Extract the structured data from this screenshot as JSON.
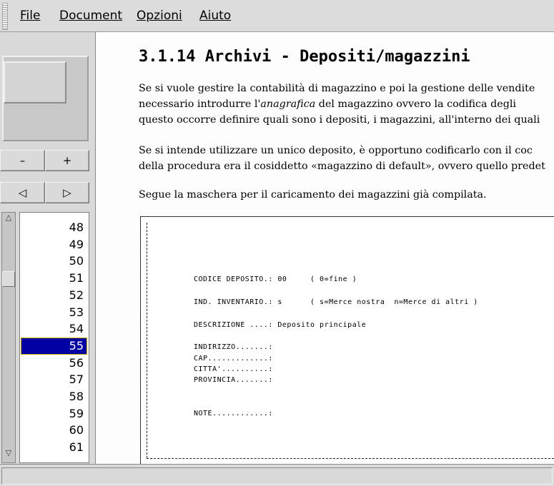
{
  "menu": {
    "file": "File",
    "document": "Document",
    "options": "Opzioni",
    "help": "Aiuto"
  },
  "zoom": {
    "minus": "–",
    "plus": "+"
  },
  "nav": {
    "prev": "◁",
    "next": "▷"
  },
  "pages": {
    "items": [
      "48",
      "49",
      "50",
      "51",
      "52",
      "53",
      "54",
      "55",
      "56",
      "57",
      "58",
      "59",
      "60",
      "61"
    ],
    "selected": "55"
  },
  "doc": {
    "title": "3.1.14 Archivi - Depositi/magazzini",
    "para1_l1": "Se si vuole gestire la contabilità di magazzino e poi la gestione delle vendite",
    "para1_l2a": "necessario introdurre l'",
    "para1_l2_italic": "anagrafica",
    "para1_l2b": " del magazzino ovvero la codifica degli",
    "para1_l3": "questo occorre definire quali sono i depositi, i magazzini, all'interno dei quali",
    "para2_l1": "Se si intende utilizzare un unico deposito, è opportuno codificarlo con il coc",
    "para2_l2": "della procedura era il cosiddetto «magazzino di default», ovvero quello predet",
    "para3": "Segue la maschera per il caricamento dei magazzini già compilata.",
    "form": {
      "line1": "CODICE DEPOSITO.: 00     ( 0=fine )",
      "line2": "IND. INVENTARIO.: s      ( s=Merce nostra  n=Merce di altri )",
      "line3": "DESCRIZIONE ....: Deposito principale",
      "line4": "INDIRIZZO.......:",
      "line5": "CAP.............:",
      "line6": "CITTA'..........:",
      "line7": "PROVINCIA.......:",
      "line8": "NOTE............:"
    }
  }
}
